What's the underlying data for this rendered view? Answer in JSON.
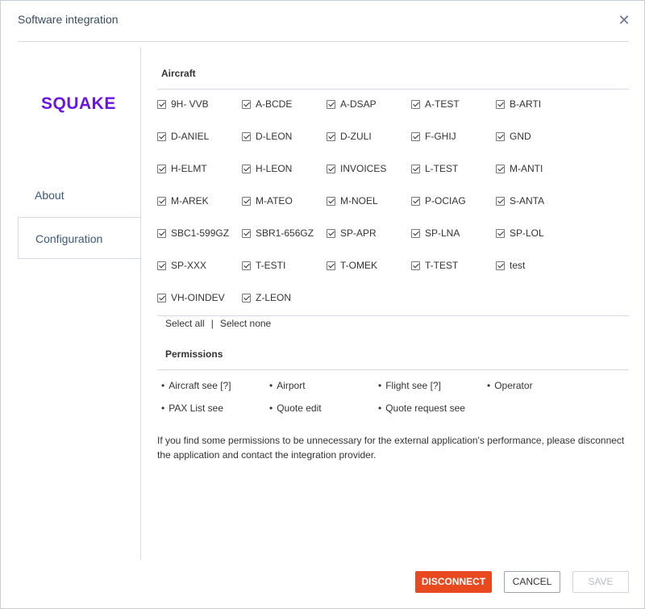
{
  "dialog": {
    "title": "Software integration",
    "close_icon": "close-icon"
  },
  "sidebar": {
    "logo": "SQUAKE",
    "items": [
      {
        "label": "About",
        "active": false
      },
      {
        "label": "Configuration",
        "active": true
      }
    ]
  },
  "aircraft": {
    "title": "Aircraft",
    "items": [
      {
        "label": "9H- VVB",
        "checked": true
      },
      {
        "label": "A-BCDE",
        "checked": true
      },
      {
        "label": "A-DSAP",
        "checked": true
      },
      {
        "label": "A-TEST",
        "checked": true
      },
      {
        "label": "B-ARTI",
        "checked": true
      },
      {
        "label": "D-ANIEL",
        "checked": true
      },
      {
        "label": "D-LEON",
        "checked": true
      },
      {
        "label": "D-ZULI",
        "checked": true
      },
      {
        "label": "F-GHIJ",
        "checked": true
      },
      {
        "label": "GND",
        "checked": true
      },
      {
        "label": "H-ELMT",
        "checked": true
      },
      {
        "label": "H-LEON",
        "checked": true
      },
      {
        "label": "INVOICES",
        "checked": true
      },
      {
        "label": "L-TEST",
        "checked": true
      },
      {
        "label": "M-ANTI",
        "checked": true
      },
      {
        "label": "M-AREK",
        "checked": true
      },
      {
        "label": "M-ATEO",
        "checked": true
      },
      {
        "label": "M-NOEL",
        "checked": true
      },
      {
        "label": "P-OCIAG",
        "checked": true
      },
      {
        "label": "S-ANTA",
        "checked": true
      },
      {
        "label": "SBC1-599GZ",
        "checked": true
      },
      {
        "label": "SBR1-656GZ",
        "checked": true
      },
      {
        "label": "SP-APR",
        "checked": true
      },
      {
        "label": "SP-LNA",
        "checked": true
      },
      {
        "label": "SP-LOL",
        "checked": true
      },
      {
        "label": "SP-XXX",
        "checked": true
      },
      {
        "label": "T-ESTI",
        "checked": true
      },
      {
        "label": "T-OMEK",
        "checked": true
      },
      {
        "label": "T-TEST",
        "checked": true
      },
      {
        "label": "test",
        "checked": true
      },
      {
        "label": "VH-OINDEV",
        "checked": true
      },
      {
        "label": "Z-LEON",
        "checked": true
      }
    ],
    "select_all": "Select all",
    "separator": "|",
    "select_none": "Select none"
  },
  "permissions": {
    "title": "Permissions",
    "items": [
      "Aircraft see [?]",
      "Airport",
      "Flight see [?]",
      "Operator",
      "PAX List see",
      "Quote edit",
      "Quote request see"
    ]
  },
  "note": "If you find some permissions to be unnecessary for the external application's performance, please disconnect the application and contact the integration provider.",
  "buttons": {
    "disconnect": "DISCONNECT",
    "cancel": "CANCEL",
    "save": "SAVE"
  }
}
